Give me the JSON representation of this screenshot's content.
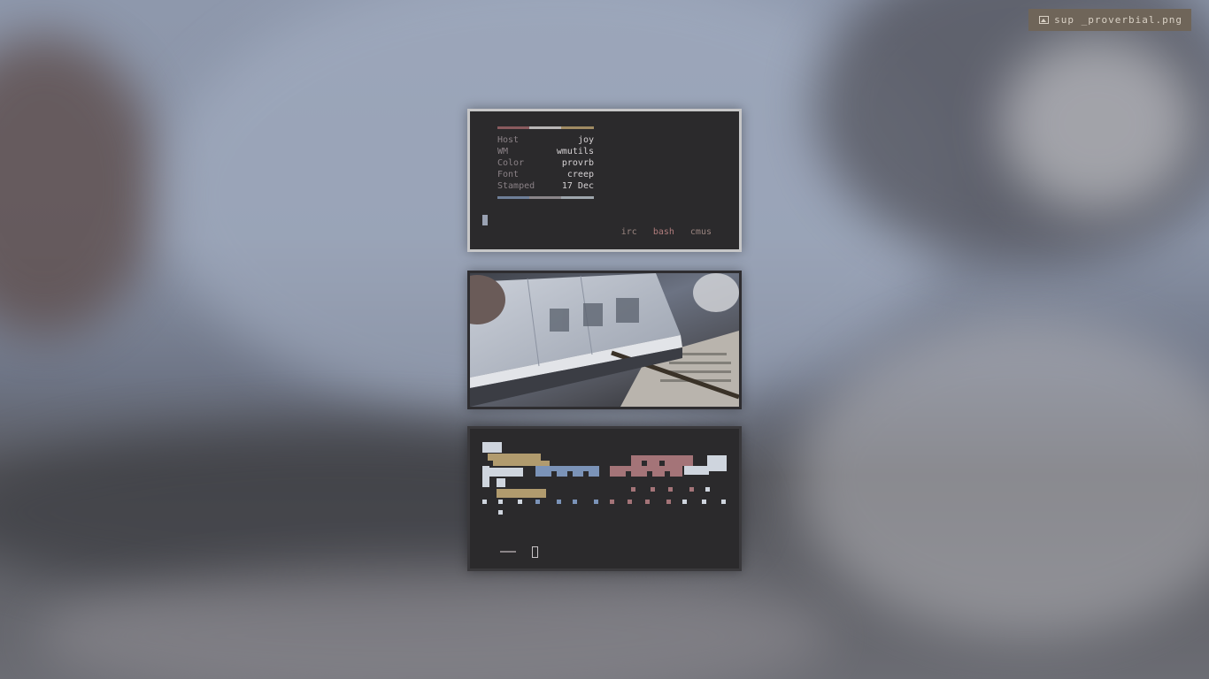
{
  "wallpaper_label": "sup _proverbial.png",
  "icons": {
    "wallpaper": "image-icon"
  },
  "colors": {
    "rule_red": "#8a5a5e",
    "rule_gray": "#b9b6b7",
    "rule_gold": "#a08b63",
    "rule_blue": "#6e7f98",
    "accent_blue": "#7b93b8",
    "accent_gold": "#b19b6e",
    "accent_rose": "#a47478",
    "accent_light": "#cfd5de"
  },
  "sysinfo": [
    {
      "key": "Host",
      "value": "joy"
    },
    {
      "key": "WM",
      "value": "wmutils"
    },
    {
      "key": "Color",
      "value": "provrb"
    },
    {
      "key": "Font",
      "value": "creep"
    },
    {
      "key": "Stamped",
      "value": "17 Dec"
    }
  ],
  "tabs": [
    "irc",
    "bash",
    "cmus"
  ]
}
